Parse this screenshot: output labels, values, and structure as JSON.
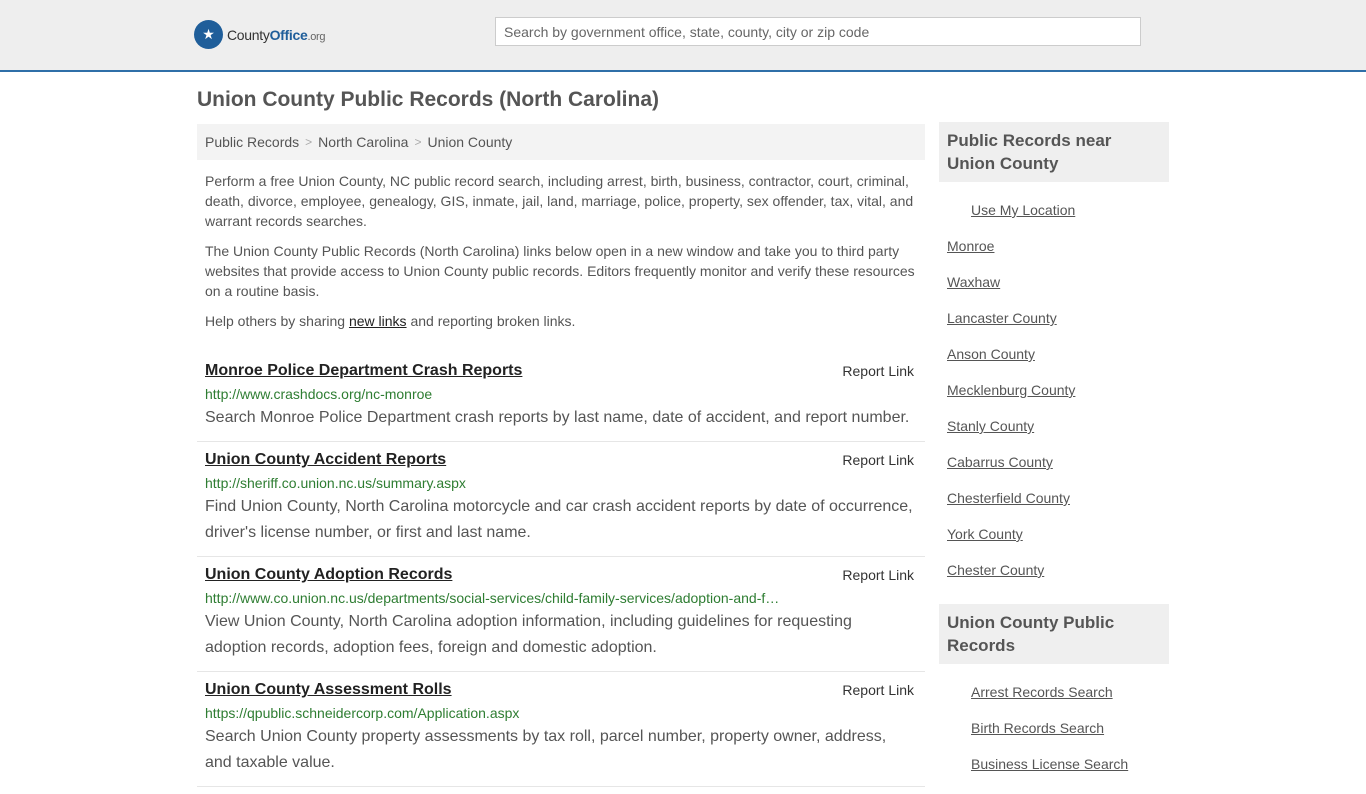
{
  "header": {
    "logo_county": "County",
    "logo_office": "Office",
    "logo_org": ".org",
    "search_placeholder": "Search by government office, state, county, city or zip code"
  },
  "page_title": "Union County Public Records (North Carolina)",
  "breadcrumb": [
    "Public Records",
    "North Carolina",
    "Union County"
  ],
  "intro": {
    "p1": "Perform a free Union County, NC public record search, including arrest, birth, business, contractor, court, criminal, death, divorce, employee, genealogy, GIS, inmate, jail, land, marriage, police, property, sex offender, tax, vital, and warrant records searches.",
    "p2": "The Union County Public Records (North Carolina) links below open in a new window and take you to third party websites that provide access to Union County public records. Editors frequently monitor and verify these resources on a routine basis.",
    "p3_before": "Help others by sharing ",
    "p3_link": "new links",
    "p3_after": " and reporting broken links."
  },
  "records": [
    {
      "title": "Monroe Police Department Crash Reports",
      "report": "Report Link",
      "url": "http://www.crashdocs.org/nc-monroe",
      "desc": "Search Monroe Police Department crash reports by last name, date of accident, and report number."
    },
    {
      "title": "Union County Accident Reports",
      "report": "Report Link",
      "url": "http://sheriff.co.union.nc.us/summary.aspx",
      "desc": "Find Union County, North Carolina motorcycle and car crash accident reports by date of occurrence, driver's license number, or first and last name."
    },
    {
      "title": "Union County Adoption Records",
      "report": "Report Link",
      "url": "http://www.co.union.nc.us/departments/social-services/child-family-services/adoption-and-f…",
      "desc": "View Union County, North Carolina adoption information, including guidelines for requesting adoption records, adoption fees, foreign and domestic adoption."
    },
    {
      "title": "Union County Assessment Rolls",
      "report": "Report Link",
      "url": "https://qpublic.schneidercorp.com/Application.aspx",
      "desc": "Search Union County property assessments by tax roll, parcel number, property owner, address, and taxable value."
    }
  ],
  "sidebar": {
    "nearby_title": "Public Records near Union County",
    "use_location": "Use My Location",
    "nearby": [
      "Monroe",
      "Waxhaw",
      "Lancaster County",
      "Anson County",
      "Mecklenburg County",
      "Stanly County",
      "Cabarrus County",
      "Chesterfield County",
      "York County",
      "Chester County"
    ],
    "county_title": "Union County Public Records",
    "county_links": [
      "Arrest Records Search",
      "Birth Records Search",
      "Business License Search"
    ]
  }
}
